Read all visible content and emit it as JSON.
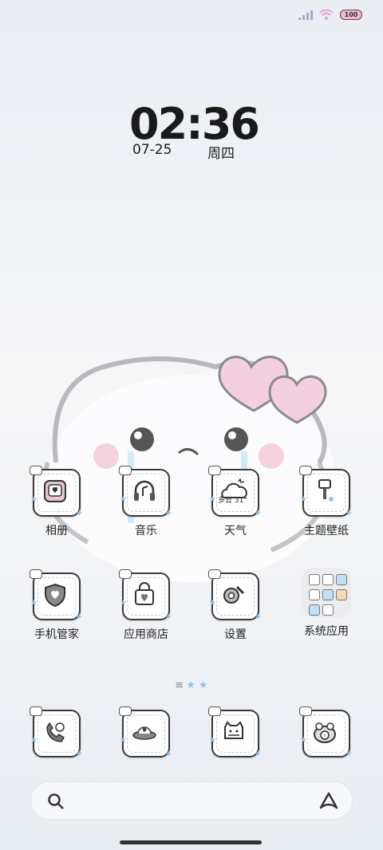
{
  "status_bar": {
    "battery": "100"
  },
  "clock": {
    "time": "02:36",
    "date": "07-25",
    "weekday": "周四"
  },
  "apps": [
    {
      "label": "相册",
      "icon": "photo-album-icon"
    },
    {
      "label": "音乐",
      "icon": "headphones-music-icon"
    },
    {
      "label": "天气",
      "icon": "weather-icon",
      "weather_text": "多云 31°"
    },
    {
      "label": "主题壁纸",
      "icon": "paintbrush-icon"
    },
    {
      "label": "手机管家",
      "icon": "shield-heart-icon"
    },
    {
      "label": "应用商店",
      "icon": "shopping-bag-icon"
    },
    {
      "label": "设置",
      "icon": "gear-wrench-icon"
    },
    {
      "label": "系统应用",
      "icon": "folder-icon"
    }
  ],
  "dock": [
    {
      "icon": "phone-cat-icon"
    },
    {
      "icon": "ufo-message-icon"
    },
    {
      "icon": "cat-contacts-icon"
    },
    {
      "icon": "frog-camera-icon"
    }
  ],
  "pager_glyph": "≡"
}
